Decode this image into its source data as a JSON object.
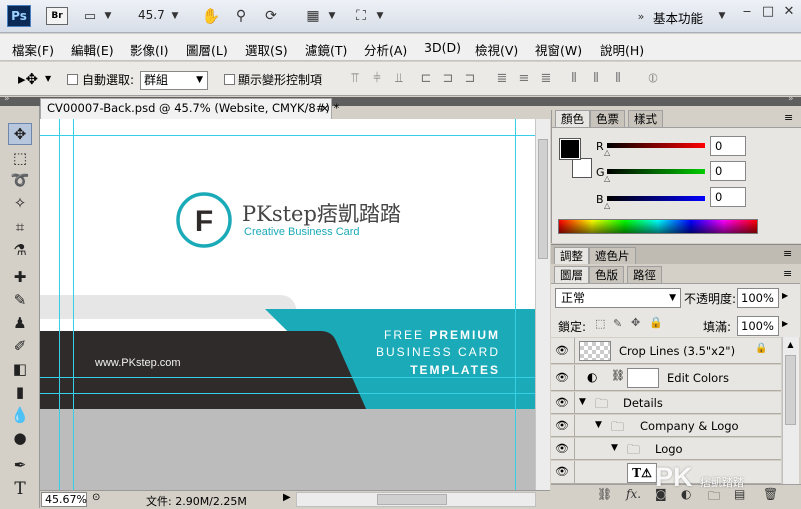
{
  "app": {
    "logo": "Ps",
    "bridge": "Br",
    "zoom": "45.7",
    "workspace": "基本功能"
  },
  "menu": [
    "檔案(F)",
    "編輯(E)",
    "影像(I)",
    "圖層(L)",
    "選取(S)",
    "濾鏡(T)",
    "分析(A)",
    "3D(D)",
    "檢視(V)",
    "視窗(W)",
    "說明(H)"
  ],
  "options": {
    "auto_select_label": "自動選取:",
    "auto_select_value": "群組",
    "show_transform_label": "顯示變形控制項"
  },
  "document": {
    "tab_title": "CV00007-Back.psd @ 45.7% (Website, CMYK/8#) *",
    "close": "×"
  },
  "card": {
    "logo_letter": "F",
    "brand": "PKstep痞凱踏踏",
    "tagline": "Creative Business Card",
    "website": "www.PKstep.com",
    "promo_line1_a": "FREE ",
    "promo_line1_b": "PREMIUM",
    "promo_line2": "BUSINESS CARD",
    "promo_line3": "TEMPLATES"
  },
  "status": {
    "zoom": "45.67%",
    "file_info": "文件: 2.90M/2.25M"
  },
  "color_panel": {
    "tabs": [
      "顏色",
      "色票",
      "樣式"
    ],
    "channels": [
      {
        "label": "R",
        "value": "0"
      },
      {
        "label": "G",
        "value": "0"
      },
      {
        "label": "B",
        "value": "0"
      }
    ]
  },
  "adjust_tabs": [
    "調整",
    "遮色片"
  ],
  "layers_panel": {
    "tabs": [
      "圖層",
      "色版",
      "路徑"
    ],
    "blend_mode": "正常",
    "opacity_label": "不透明度:",
    "opacity": "100%",
    "lock_label": "鎖定:",
    "fill_label": "填滿:",
    "fill": "100%",
    "layers": [
      {
        "name": "Crop Lines (3.5\"x2\")"
      },
      {
        "name": "Edit Colors"
      },
      {
        "name": "Details"
      },
      {
        "name": "Company & Logo"
      },
      {
        "name": "Logo"
      }
    ]
  },
  "watermark": {
    "logo": "PK",
    "text": "痞凱踏踏"
  },
  "colors": {
    "teal": "#1aaab8",
    "dark": "#2f2b2a",
    "guide": "#35d0e8"
  }
}
